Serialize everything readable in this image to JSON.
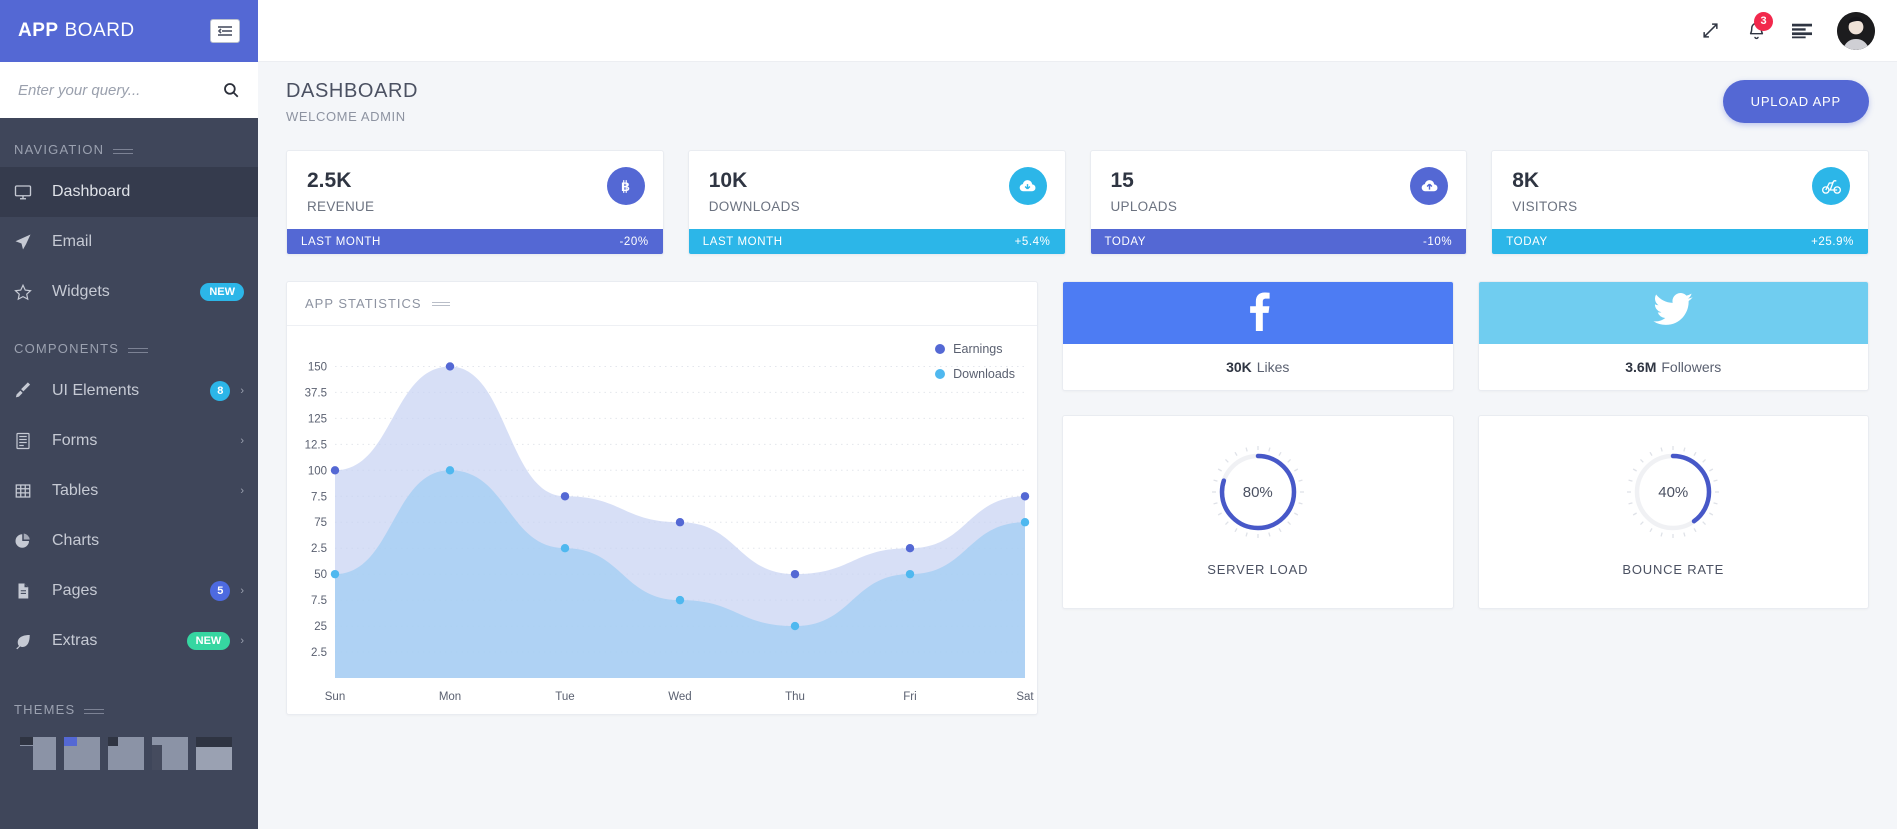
{
  "brand": {
    "bold": "APP",
    "light": "BOARD"
  },
  "search": {
    "placeholder": "Enter your query...",
    "value": "",
    "icon": "search-icon"
  },
  "sidebar": {
    "sections": [
      {
        "title": "NAVIGATION"
      },
      {
        "title": "COMPONENTS"
      },
      {
        "title": "THEMES"
      }
    ],
    "nav_items": [
      {
        "label": "Dashboard",
        "icon": "monitor-icon",
        "active": true,
        "badge": null,
        "chevron": false
      },
      {
        "label": "Email",
        "icon": "paper-plane-icon",
        "active": false,
        "badge": null,
        "chevron": false
      },
      {
        "label": "Widgets",
        "icon": "star-icon",
        "active": false,
        "badge": "NEW",
        "badge_style": "new-blue",
        "chevron": false
      }
    ],
    "component_items": [
      {
        "label": "UI Elements",
        "icon": "brush-icon",
        "badge": "8",
        "badge_style": "round",
        "chevron": true
      },
      {
        "label": "Forms",
        "icon": "form-icon",
        "badge": null,
        "chevron": true
      },
      {
        "label": "Tables",
        "icon": "table-icon",
        "badge": null,
        "chevron": true
      },
      {
        "label": "Charts",
        "icon": "pie-chart-icon",
        "badge": null,
        "chevron": false
      },
      {
        "label": "Pages",
        "icon": "document-icon",
        "badge": "5",
        "badge_style": "round-blue",
        "chevron": true
      },
      {
        "label": "Extras",
        "icon": "leaf-icon",
        "badge": "NEW",
        "badge_style": "new-green",
        "chevron": true
      }
    ],
    "themes": [
      {
        "name": "theme-1"
      },
      {
        "name": "theme-2"
      },
      {
        "name": "theme-3"
      },
      {
        "name": "theme-4"
      },
      {
        "name": "theme-5"
      }
    ]
  },
  "topbar": {
    "menu_toggle_icon": "hamburger-icon",
    "icons": [
      {
        "name": "expand-icon"
      },
      {
        "name": "bell-icon",
        "badge": "3"
      },
      {
        "name": "list-icon"
      }
    ],
    "avatar": "user-avatar"
  },
  "page": {
    "title": "DASHBOARD",
    "subtitle": "WELCOME ADMIN",
    "upload_label": "UPLOAD APP"
  },
  "stats": [
    {
      "value": "2.5K",
      "label": "REVENUE",
      "icon": "bitcoin-icon",
      "icon_bg": "#5468d4",
      "foot_left": "LAST MONTH",
      "foot_right": "-20%",
      "foot_bg": "#5468d4"
    },
    {
      "value": "10K",
      "label": "DOWNLOADS",
      "icon": "cloud-download-icon",
      "icon_bg": "#2cb6e8",
      "foot_left": "LAST MONTH",
      "foot_right": "+5.4%",
      "foot_bg": "#2cb6e8"
    },
    {
      "value": "15",
      "label": "UPLOADS",
      "icon": "cloud-upload-icon",
      "icon_bg": "#5468d4",
      "foot_left": "TODAY",
      "foot_right": "-10%",
      "foot_bg": "#5468d4"
    },
    {
      "value": "8K",
      "label": "VISITORS",
      "icon": "bicycle-icon",
      "icon_bg": "#2cb6e8",
      "foot_left": "TODAY",
      "foot_right": "+25.9%",
      "foot_bg": "#2cb6e8"
    }
  ],
  "chart_panel": {
    "title": "APP STATISTICS"
  },
  "chart_data": {
    "type": "area",
    "title": "APP STATISTICS",
    "xlabel": "",
    "ylabel": "",
    "categories": [
      "Sun",
      "Mon",
      "Tue",
      "Wed",
      "Thu",
      "Fri",
      "Sat"
    ],
    "ytick_labels": [
      "150",
      "37.5",
      "125",
      "12.5",
      "100",
      "7.5",
      "75",
      "2.5",
      "50",
      "7.5",
      "25",
      "2.5"
    ],
    "ytick_values": [
      150,
      137.5,
      125,
      112.5,
      100,
      87.5,
      75,
      62.5,
      50,
      37.5,
      25,
      12.5
    ],
    "ylim": [
      0,
      150
    ],
    "grid": true,
    "legend_position": "top-right",
    "series": [
      {
        "name": "Earnings",
        "color": "#5468d4",
        "fill": "#c8d3f2",
        "values": [
          100,
          150,
          87.5,
          75,
          50,
          62.5,
          87.5
        ]
      },
      {
        "name": "Downloads",
        "color": "#4fb8ef",
        "fill": "#9fcdf3",
        "values": [
          50,
          100,
          62.5,
          37.5,
          25,
          50,
          75
        ]
      }
    ]
  },
  "social": [
    {
      "network": "facebook",
      "icon": "facebook-icon",
      "bg": "#4d7cf3",
      "count": "30K",
      "label": "Likes"
    },
    {
      "network": "twitter",
      "icon": "twitter-icon",
      "bg": "#70cdf0",
      "count": "3.6M",
      "label": "Followers"
    }
  ],
  "gauges": [
    {
      "value": "80%",
      "percent": 80,
      "label": "SERVER LOAD",
      "color": "#4758c8"
    },
    {
      "value": "40%",
      "percent": 40,
      "label": "BOUNCE RATE",
      "color": "#4758c8"
    }
  ]
}
